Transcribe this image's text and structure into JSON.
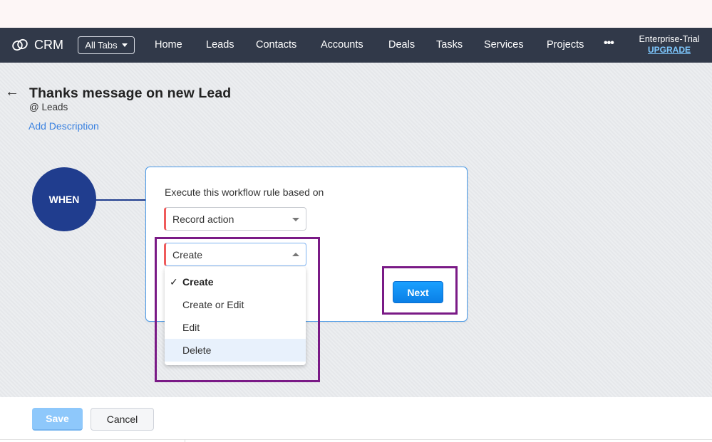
{
  "app": {
    "brand": "CRM",
    "all_tabs_label": "All Tabs",
    "nav_items": [
      "Home",
      "Leads",
      "Contacts",
      "Accounts",
      "Deals",
      "Tasks",
      "Services",
      "Projects"
    ],
    "more_label": "•••",
    "plan": "Enterprise-Trial",
    "upgrade_label": "UPGRADE"
  },
  "page": {
    "back_icon": "←",
    "title": "Thanks message on new Lead",
    "module": "@ Leads",
    "add_description": "Add Description"
  },
  "workflow": {
    "when_label": "WHEN",
    "prompt": "Execute this workflow rule based on",
    "trigger_select": {
      "value": "Record action"
    },
    "action_select": {
      "value": "Create",
      "options": [
        {
          "label": "Create",
          "selected": true,
          "hovered": false
        },
        {
          "label": "Create or Edit",
          "selected": false,
          "hovered": false
        },
        {
          "label": "Edit",
          "selected": false,
          "hovered": false
        },
        {
          "label": "Delete",
          "selected": false,
          "hovered": true
        }
      ]
    },
    "next_label": "Next",
    "check_icon": "✓"
  },
  "footer": {
    "save_label": "Save",
    "cancel_label": "Cancel"
  },
  "colors": {
    "navbar": "#313949",
    "accent_blue": "#0a7fe6",
    "when_circle": "#203d8e",
    "required_marker": "#ef5b5b",
    "highlight_box": "#7a1a86"
  }
}
